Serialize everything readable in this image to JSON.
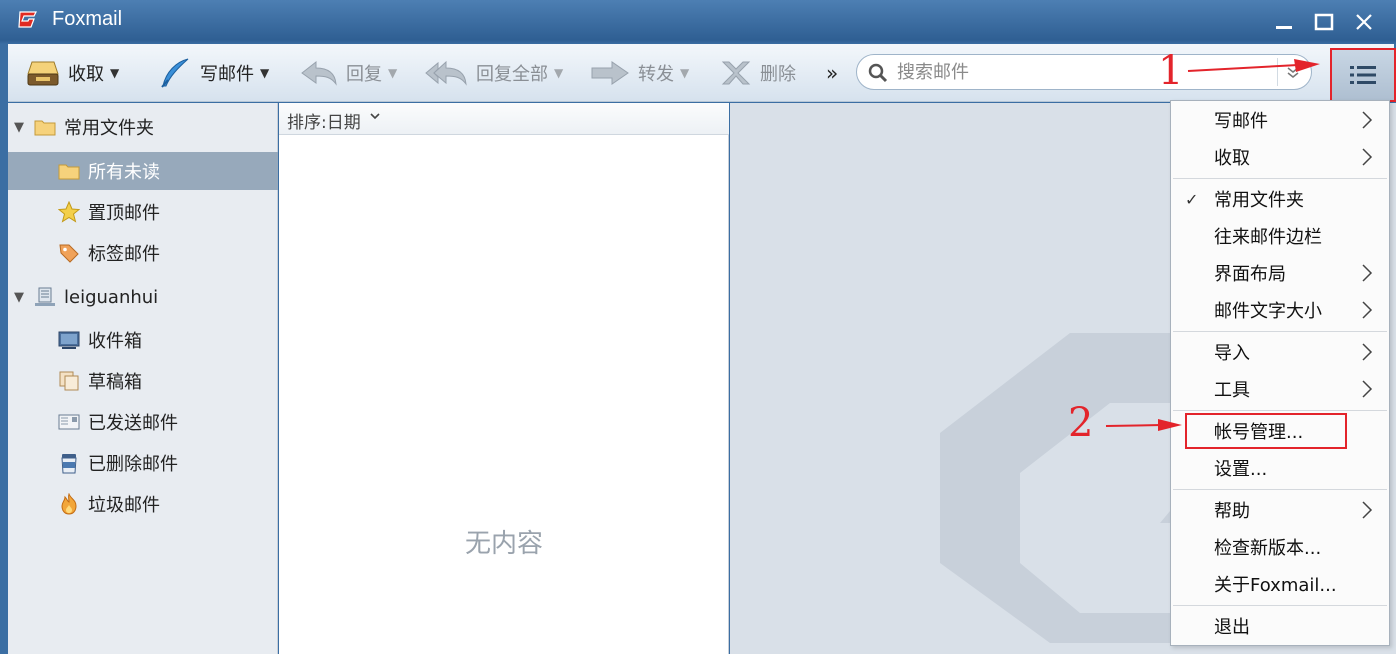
{
  "window": {
    "title": "Foxmail"
  },
  "toolbar": {
    "receive": "收取",
    "compose": "写邮件",
    "reply": "回复",
    "reply_all": "回复全部",
    "forward": "转发",
    "delete": "删除",
    "more": "»",
    "search_placeholder": "搜索邮件"
  },
  "sidebar": {
    "favorites": {
      "label": "常用文件夹",
      "items": [
        "所有未读",
        "置顶邮件",
        "标签邮件"
      ]
    },
    "account": {
      "label": "leiguanhui",
      "items": [
        "收件箱",
        "草稿箱",
        "已发送邮件",
        "已删除邮件",
        "垃圾邮件"
      ]
    },
    "selected": "所有未读"
  },
  "list": {
    "sort_label": "排序:日期",
    "empty_text": "无内容"
  },
  "menu": {
    "items": [
      {
        "label": "写邮件",
        "submenu": true
      },
      {
        "label": "收取",
        "submenu": true
      },
      {
        "label": "常用文件夹",
        "checked": true
      },
      {
        "label": "往来邮件边栏"
      },
      {
        "label": "界面布局",
        "submenu": true
      },
      {
        "label": "邮件文字大小",
        "submenu": true
      },
      {
        "label": "导入",
        "submenu": true
      },
      {
        "label": "工具",
        "submenu": true
      },
      {
        "label": "帐号管理..."
      },
      {
        "label": "设置..."
      },
      {
        "label": "帮助",
        "submenu": true
      },
      {
        "label": "检查新版本..."
      },
      {
        "label": "关于Foxmail..."
      },
      {
        "label": "退出"
      }
    ],
    "check_mark": "✓"
  },
  "annotations": {
    "step1": "1",
    "step2": "2"
  },
  "colors": {
    "accent_red": "#e3242b",
    "selected_row": "#97a9bb"
  }
}
